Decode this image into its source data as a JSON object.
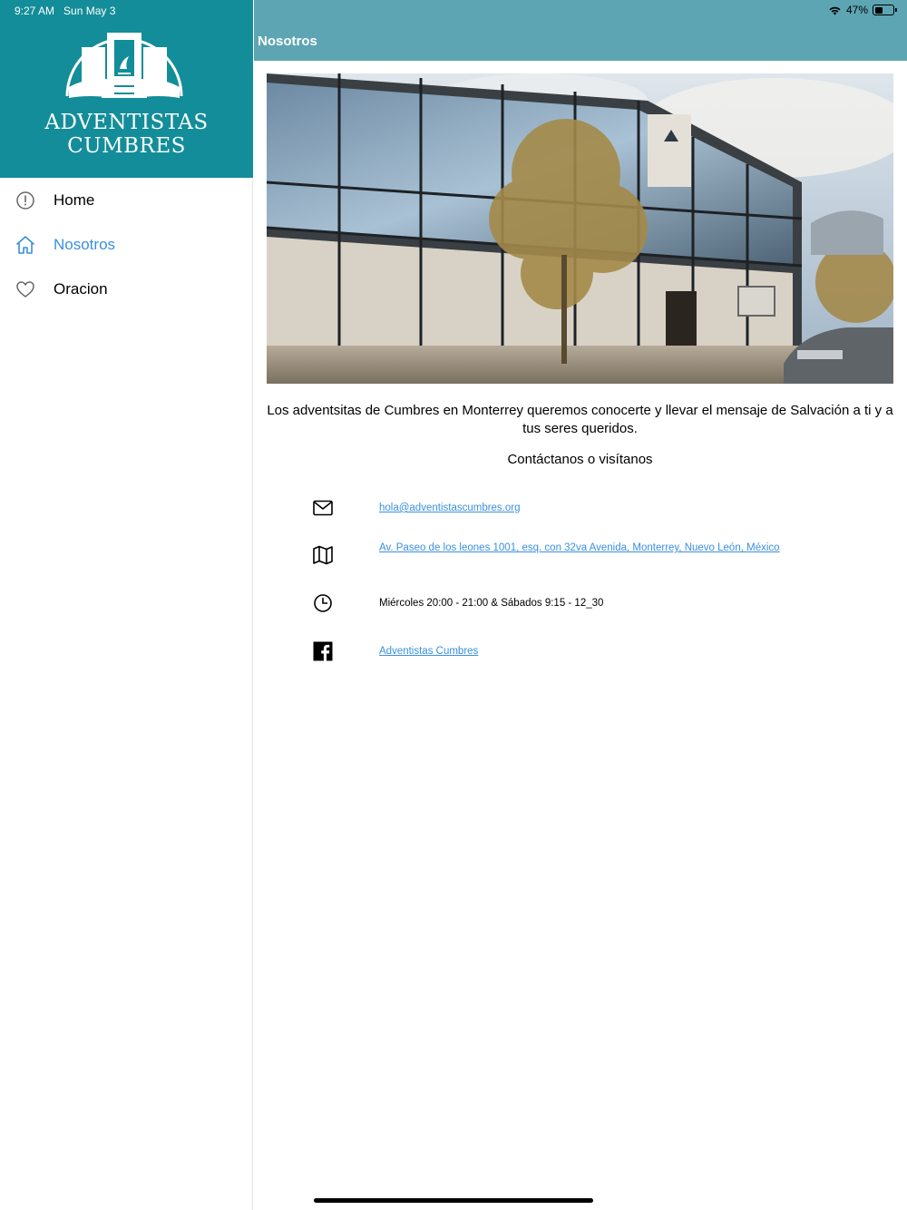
{
  "status": {
    "time": "9:27 AM",
    "date": "Sun May 3",
    "battery": "47%",
    "battery_level": 0.47
  },
  "sidebar": {
    "logo_line1": "ADVENTISTAS",
    "logo_line2": "CUMBRES",
    "items": [
      {
        "label": "Home",
        "icon": "alert-circle-icon"
      },
      {
        "label": "Nosotros",
        "icon": "home-icon",
        "active": true
      },
      {
        "label": "Oracion",
        "icon": "heart-icon"
      }
    ]
  },
  "page": {
    "title": "Nosotros",
    "intro": "Los adventsitas de Cumbres en Monterrey queremos conocerte y llevar el mensaje de Salvación a ti y a tus seres queridos.",
    "contact_heading": "Contáctanos o visítanos",
    "contacts": [
      {
        "icon": "mail-icon",
        "text": "hola@adventistascumbres.org",
        "link": true
      },
      {
        "icon": "map-icon",
        "text": "Av. Paseo de los leones 1001, esq. con 32va Avenida, Monterrey, Nuevo León, México",
        "link": true
      },
      {
        "icon": "clock-icon",
        "text": "Miércoles 20:00 - 21:00 & Sábados 9:15 - 12_30",
        "link": false
      },
      {
        "icon": "facebook-icon",
        "text": "Adventistas Cumbres",
        "link": true
      }
    ]
  },
  "colors": {
    "sidebar_header": "#138d99",
    "topbar": "#5da5b3",
    "accent": "#3a8fe0"
  }
}
